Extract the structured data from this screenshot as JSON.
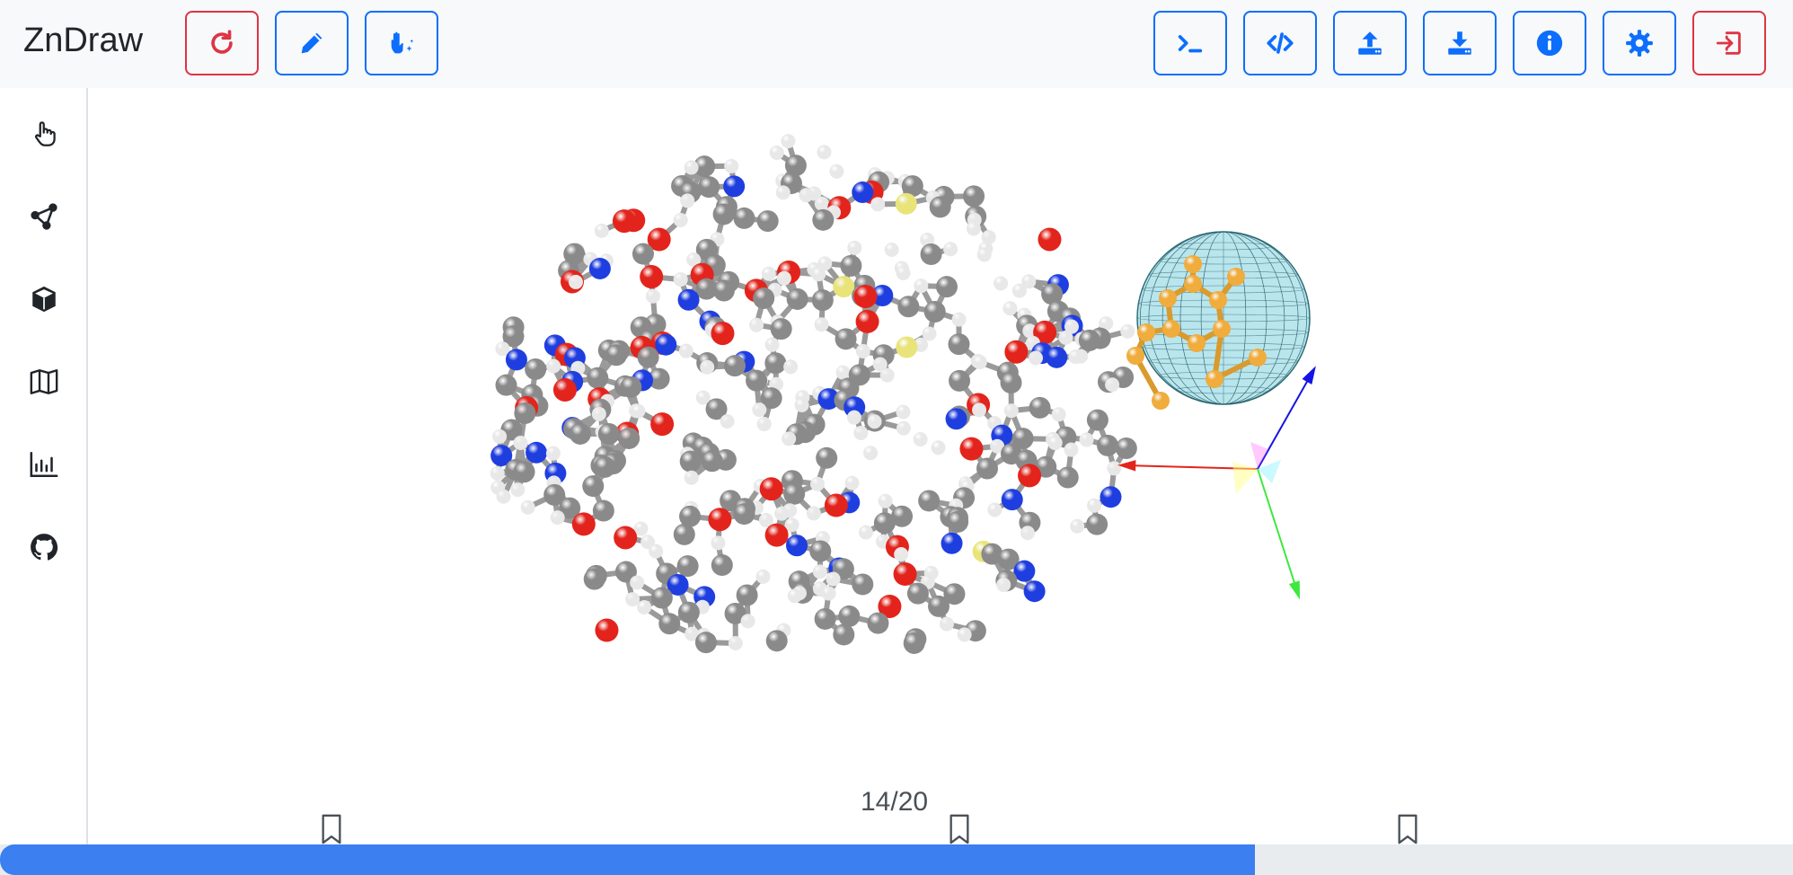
{
  "app": {
    "brand": "ZnDraw"
  },
  "toolbar": {
    "left": [
      {
        "name": "refresh-button",
        "icon": "refresh-icon",
        "variant": "danger"
      },
      {
        "name": "edit-button",
        "icon": "pencil-icon",
        "variant": "primary"
      },
      {
        "name": "interaction-button",
        "icon": "hand-sparkle-icon",
        "variant": "primary"
      }
    ],
    "right": [
      {
        "name": "terminal-button",
        "icon": "terminal-icon",
        "variant": "primary"
      },
      {
        "name": "code-button",
        "icon": "code-icon",
        "variant": "primary"
      },
      {
        "name": "upload-button",
        "icon": "upload-icon",
        "variant": "primary"
      },
      {
        "name": "download-button",
        "icon": "download-icon",
        "variant": "primary"
      },
      {
        "name": "info-button",
        "icon": "info-icon",
        "variant": "primary"
      },
      {
        "name": "settings-button",
        "icon": "gear-icon",
        "variant": "primary"
      },
      {
        "name": "logout-button",
        "icon": "exit-icon",
        "variant": "danger"
      }
    ]
  },
  "sidebar": {
    "items": [
      {
        "name": "selection",
        "icon": "pointer-hand-icon"
      },
      {
        "name": "geometry",
        "icon": "vertex-graph-icon"
      },
      {
        "name": "modifiers",
        "icon": "cube-icon"
      },
      {
        "name": "analysis",
        "icon": "map-icon"
      },
      {
        "name": "plots",
        "icon": "bar-chart-icon"
      },
      {
        "name": "github",
        "icon": "github-icon"
      }
    ]
  },
  "colors": {
    "primary": "#0d6efd",
    "danger": "#dc3545",
    "progress": "#3b7ff0",
    "carbon": "#8a8a8a",
    "oxygen": "#e3241c",
    "nitrogen": "#1f3ee0",
    "hydrogen": "#e8e8e8",
    "sulfur": "#e8e47a",
    "selected": "#f0ac3c",
    "sphere": "#7fd0de"
  },
  "timeline": {
    "frame_label": "14/20",
    "current_frame": 14,
    "total_frames": 20,
    "progress_fraction": 0.7,
    "bookmarks": [
      3,
      10,
      15
    ]
  }
}
